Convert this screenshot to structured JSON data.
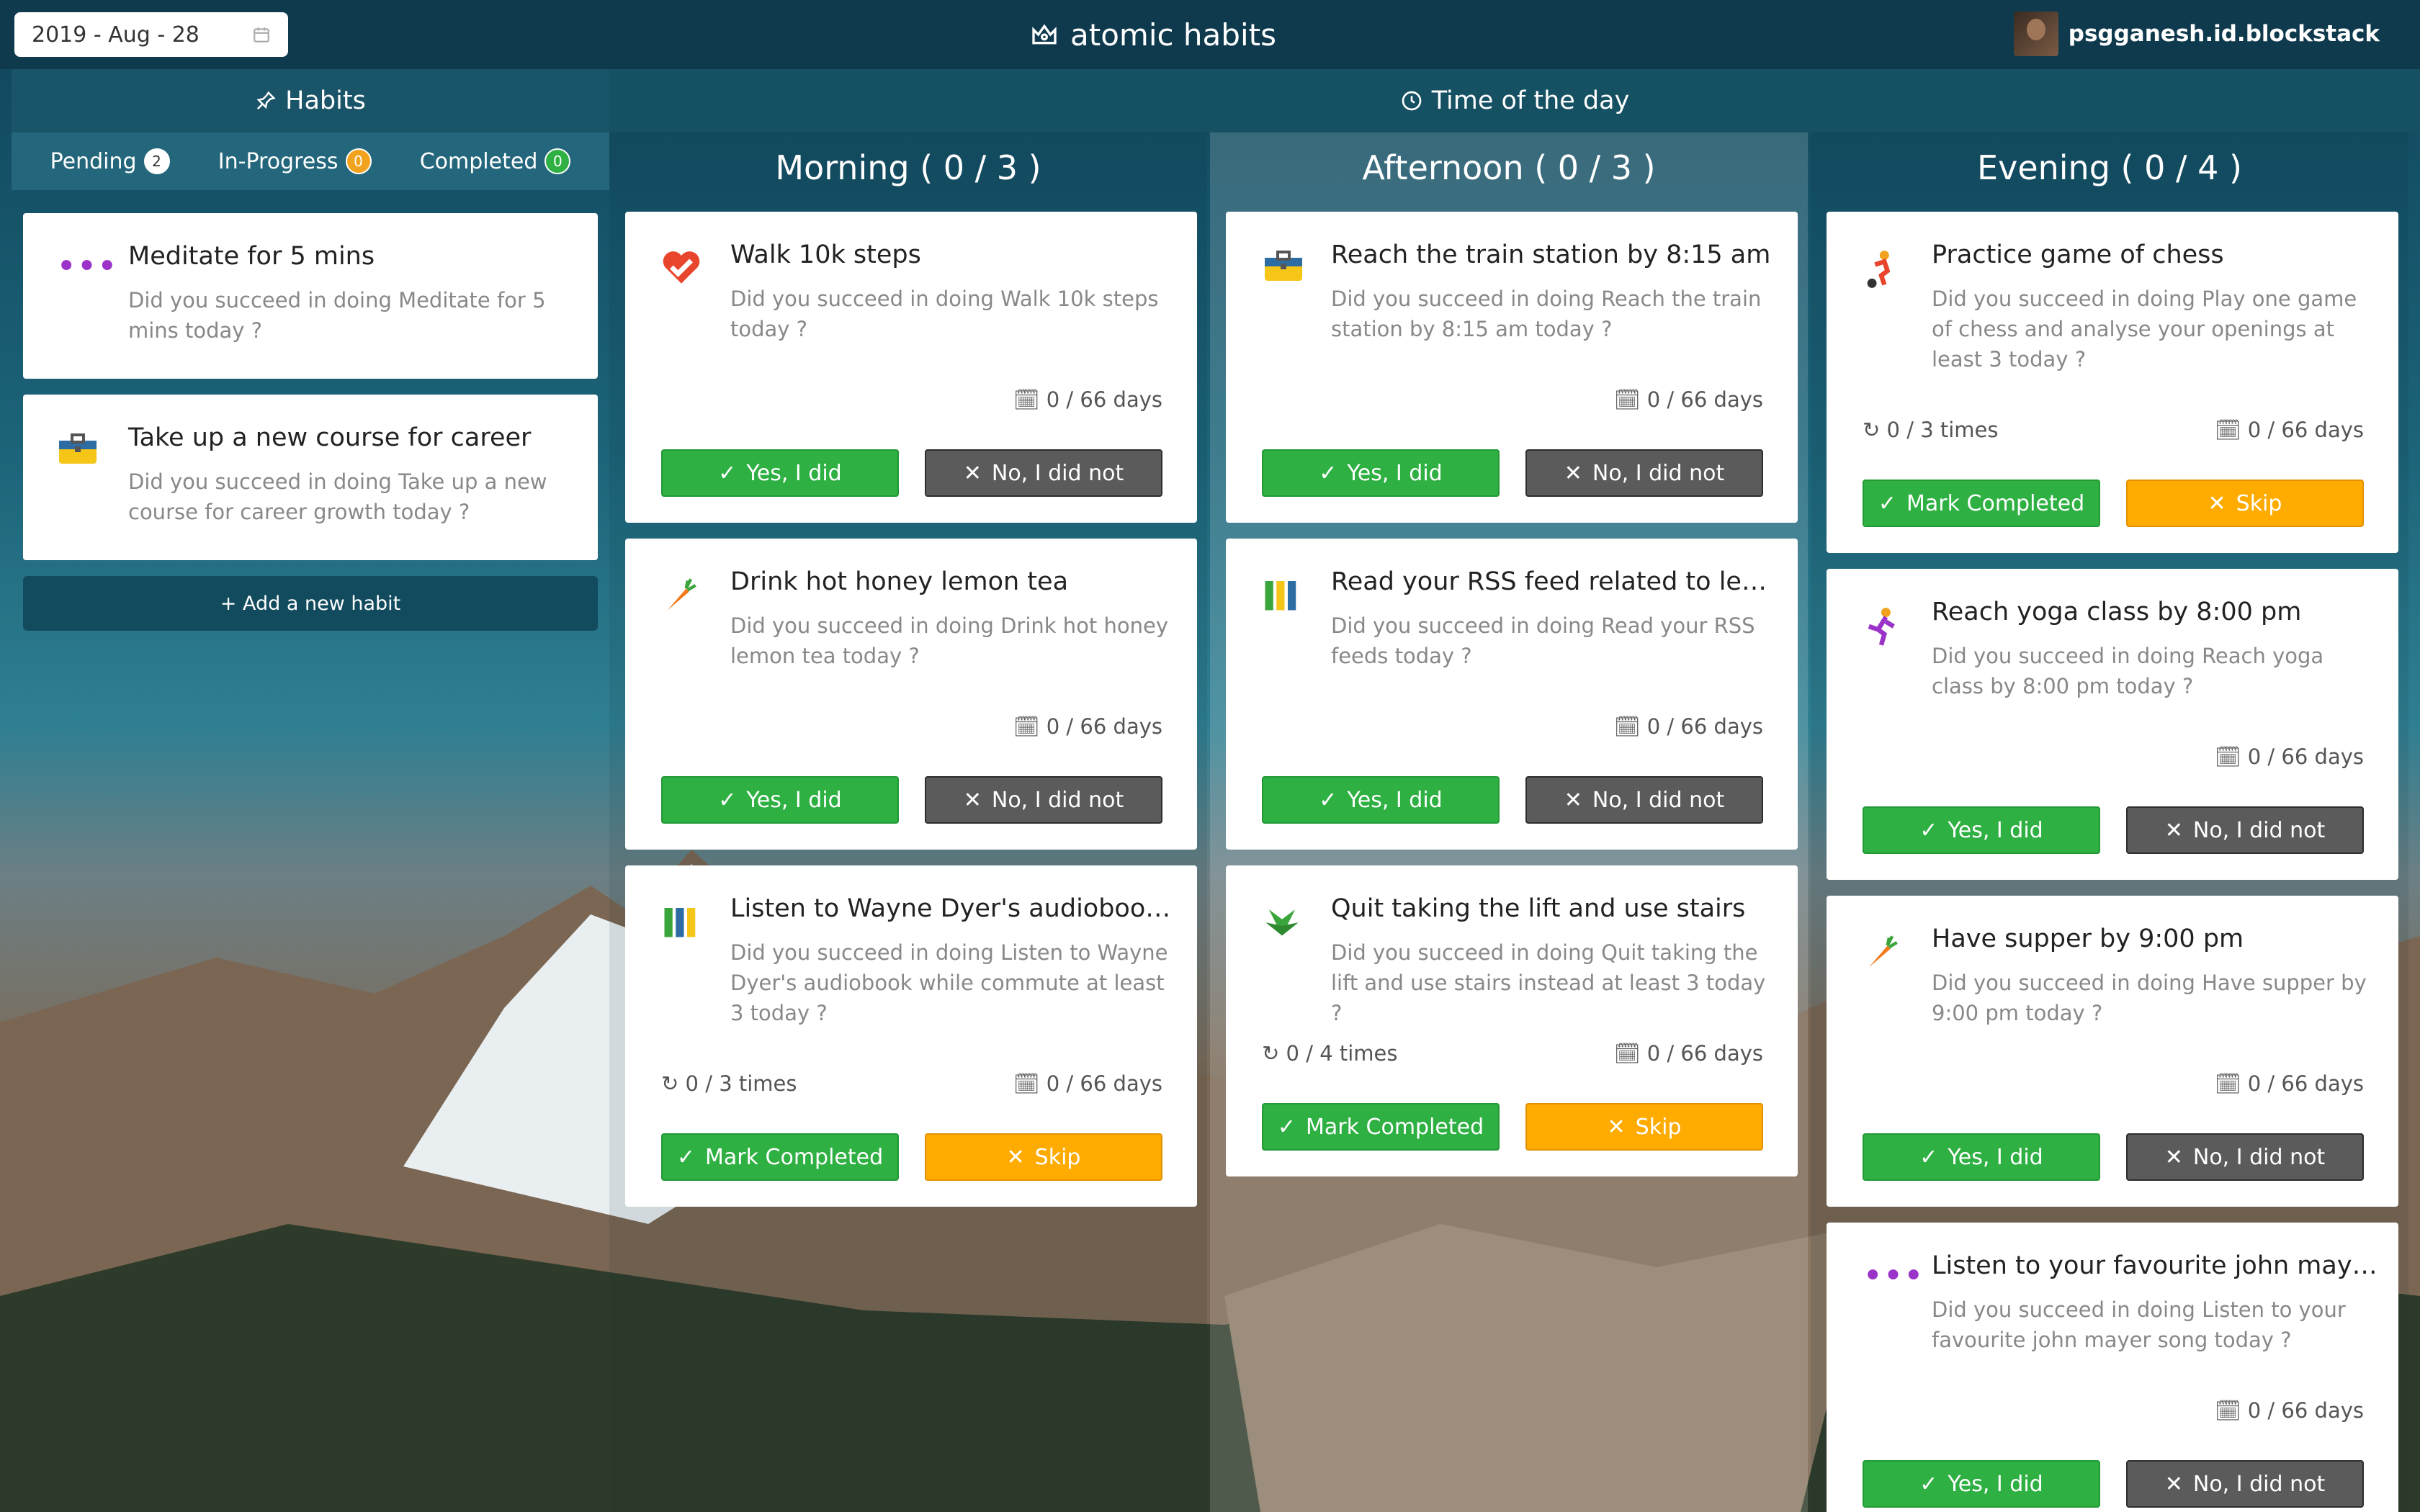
{
  "header": {
    "date": "2019 - Aug - 28",
    "app_title": "atomic habits",
    "username": "psgganesh.id.blockstack"
  },
  "sections": {
    "habits": "Habits",
    "time_of_day": "Time of the day"
  },
  "status_tabs": [
    {
      "label": "Pending",
      "count": "2"
    },
    {
      "label": "In-Progress",
      "count": "0"
    },
    {
      "label": "Completed",
      "count": "0"
    }
  ],
  "pending_habits": [
    {
      "title": "Meditate for 5 mins",
      "desc": "Did you succeed in doing Meditate for 5 mins today ?",
      "icon": "dots-icon"
    },
    {
      "title": "Take up a new course for career",
      "desc": "Did you succeed in doing Take up a new course for career growth today ?",
      "icon": "briefcase-icon"
    }
  ],
  "add_habit": "+ Add a new habit",
  "columns": [
    {
      "title": "Morning ( 0 / 3 )",
      "cards": [
        {
          "title": "Walk 10k steps",
          "desc": "Did you succeed in doing Walk 10k steps today ?",
          "days": "0 / 66 days",
          "yes": "Yes, I did",
          "no": "No, I did not",
          "icon": "heart-icon"
        },
        {
          "title": "Drink hot honey lemon tea",
          "desc": "Did you succeed in doing Drink hot honey lemon tea today ?",
          "days": "0 / 66 days",
          "yes": "Yes, I did",
          "no": "No, I did not",
          "icon": "carrot-icon"
        },
        {
          "title": "Listen to Wayne Dyer's audiobook w...",
          "desc": "Did you succeed in doing Listen to Wayne Dyer's audiobook while commute at least 3 today ?",
          "times": "0 / 3 times",
          "days": "0 / 66 days",
          "yes": "Mark Completed",
          "no": "Skip",
          "icon": "books-icon"
        }
      ]
    },
    {
      "title": "Afternoon ( 0 / 3 )",
      "cards": [
        {
          "title": "Reach the train station by 8:15 am",
          "desc": "Did you succeed in doing Reach the train station by 8:15 am today ?",
          "days": "0 / 66 days",
          "yes": "Yes, I did",
          "no": "No, I did not",
          "icon": "briefcase-icon"
        },
        {
          "title": "Read your RSS feed related to learning",
          "desc": "Did you succeed in doing Read your RSS feeds today ?",
          "days": "0 / 66 days",
          "yes": "Yes, I did",
          "no": "No, I did not",
          "icon": "books-icon"
        },
        {
          "title": "Quit taking the lift and use stairs",
          "desc": "Did you succeed in doing Quit taking the lift and use stairs instead at least 3 today ?",
          "times": "0 / 4 times",
          "days": "0 / 66 days",
          "yes": "Mark Completed",
          "no": "Skip",
          "icon": "leaf-icon"
        }
      ]
    },
    {
      "title": "Evening ( 0 / 4 )",
      "cards": [
        {
          "title": "Practice game of chess",
          "desc": "Did you succeed in doing Play one game of chess and analyse your openings at least 3 today ?",
          "times": "0 / 3 times",
          "days": "0 / 66 days",
          "yes": "Mark Completed",
          "no": "Skip",
          "icon": "sport-icon"
        },
        {
          "title": "Reach yoga class by 8:00 pm",
          "desc": "Did you succeed in doing Reach yoga class by 8:00 pm today ?",
          "days": "0 / 66 days",
          "yes": "Yes, I did",
          "no": "No, I did not",
          "icon": "dancer-icon"
        },
        {
          "title": "Have supper by 9:00 pm",
          "desc": "Did you succeed in doing Have supper by 9:00 pm today ?",
          "days": "0 / 66 days",
          "yes": "Yes, I did",
          "no": "No, I did not",
          "icon": "carrot-icon"
        },
        {
          "title": "Listen to your favourite john mayer ...",
          "desc": "Did you succeed in doing Listen to your favourite john mayer song today ?",
          "days": "0 / 66 days",
          "yes": "Yes, I did",
          "no": "No, I did not",
          "icon": "dots-icon"
        }
      ]
    }
  ],
  "colors": {
    "topbar": "#0f3a4d",
    "success": "#2fb043",
    "skip": "#ffab00",
    "no": "#5b5b5b"
  }
}
